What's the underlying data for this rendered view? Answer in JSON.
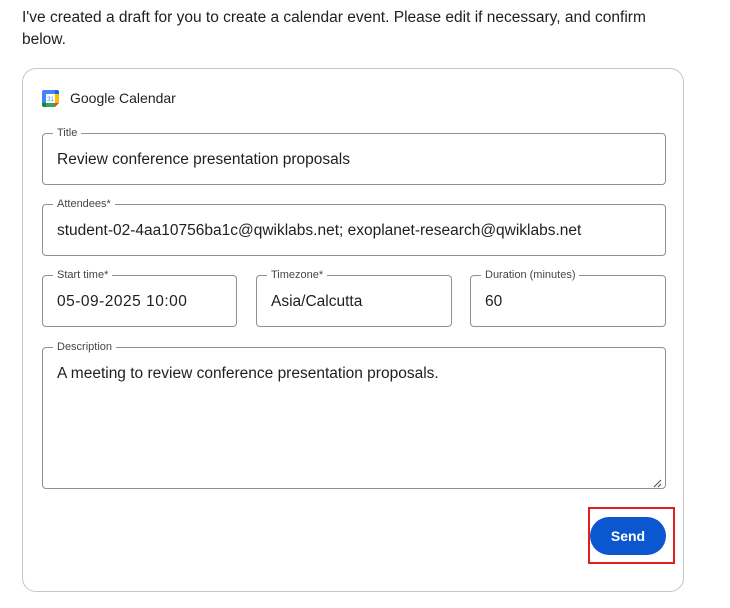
{
  "intro_text": "I've created a draft for you to create a calendar event. Please edit if necessary, and confirm below.",
  "card": {
    "app_name": "Google Calendar",
    "app_icon": "google-calendar-icon",
    "icon_day": "31"
  },
  "fields": {
    "title": {
      "label": "Title",
      "value": "Review conference presentation proposals"
    },
    "attendees": {
      "label": "Attendees*",
      "value": "student-02-4aa10756ba1c@qwiklabs.net; exoplanet-research@qwiklabs.net"
    },
    "start_time": {
      "label": "Start time*",
      "value": "05-09-2025 10:00"
    },
    "timezone": {
      "label": "Timezone*",
      "value": "Asia/Calcutta"
    },
    "duration": {
      "label": "Duration (minutes)",
      "value": "60"
    },
    "description": {
      "label": "Description",
      "value": "A meeting to review conference presentation proposals."
    }
  },
  "send_button": {
    "label": "Send"
  },
  "colors": {
    "accent": "#0b57d0",
    "highlight": "#e02020",
    "border": "#8e918f"
  }
}
